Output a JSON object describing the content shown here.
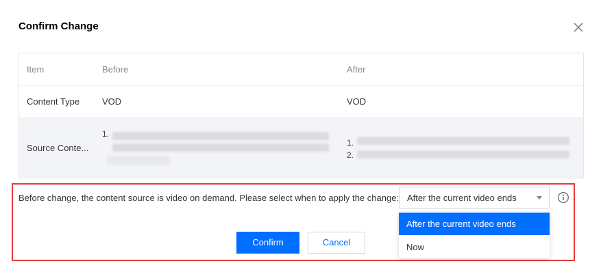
{
  "dialog": {
    "title": "Confirm Change",
    "close_icon": "close-icon"
  },
  "table": {
    "headers": [
      "Item",
      "Before",
      "After"
    ],
    "rows": [
      {
        "item": "Content Type",
        "before": "VOD",
        "after": "VOD"
      },
      {
        "item": "Source Conte...",
        "before_index": [
          "1."
        ],
        "after_index": [
          "1.",
          "2."
        ]
      }
    ]
  },
  "apply": {
    "prompt": "Before change, the content source is video on demand. Please select when to apply the change:",
    "selected": "After the current video ends",
    "options": [
      "After the current video ends",
      "Now"
    ],
    "info_icon": "info-icon"
  },
  "buttons": {
    "confirm": "Confirm",
    "cancel": "Cancel"
  },
  "colors": {
    "primary": "#006eff",
    "highlight": "#e63a3a"
  }
}
